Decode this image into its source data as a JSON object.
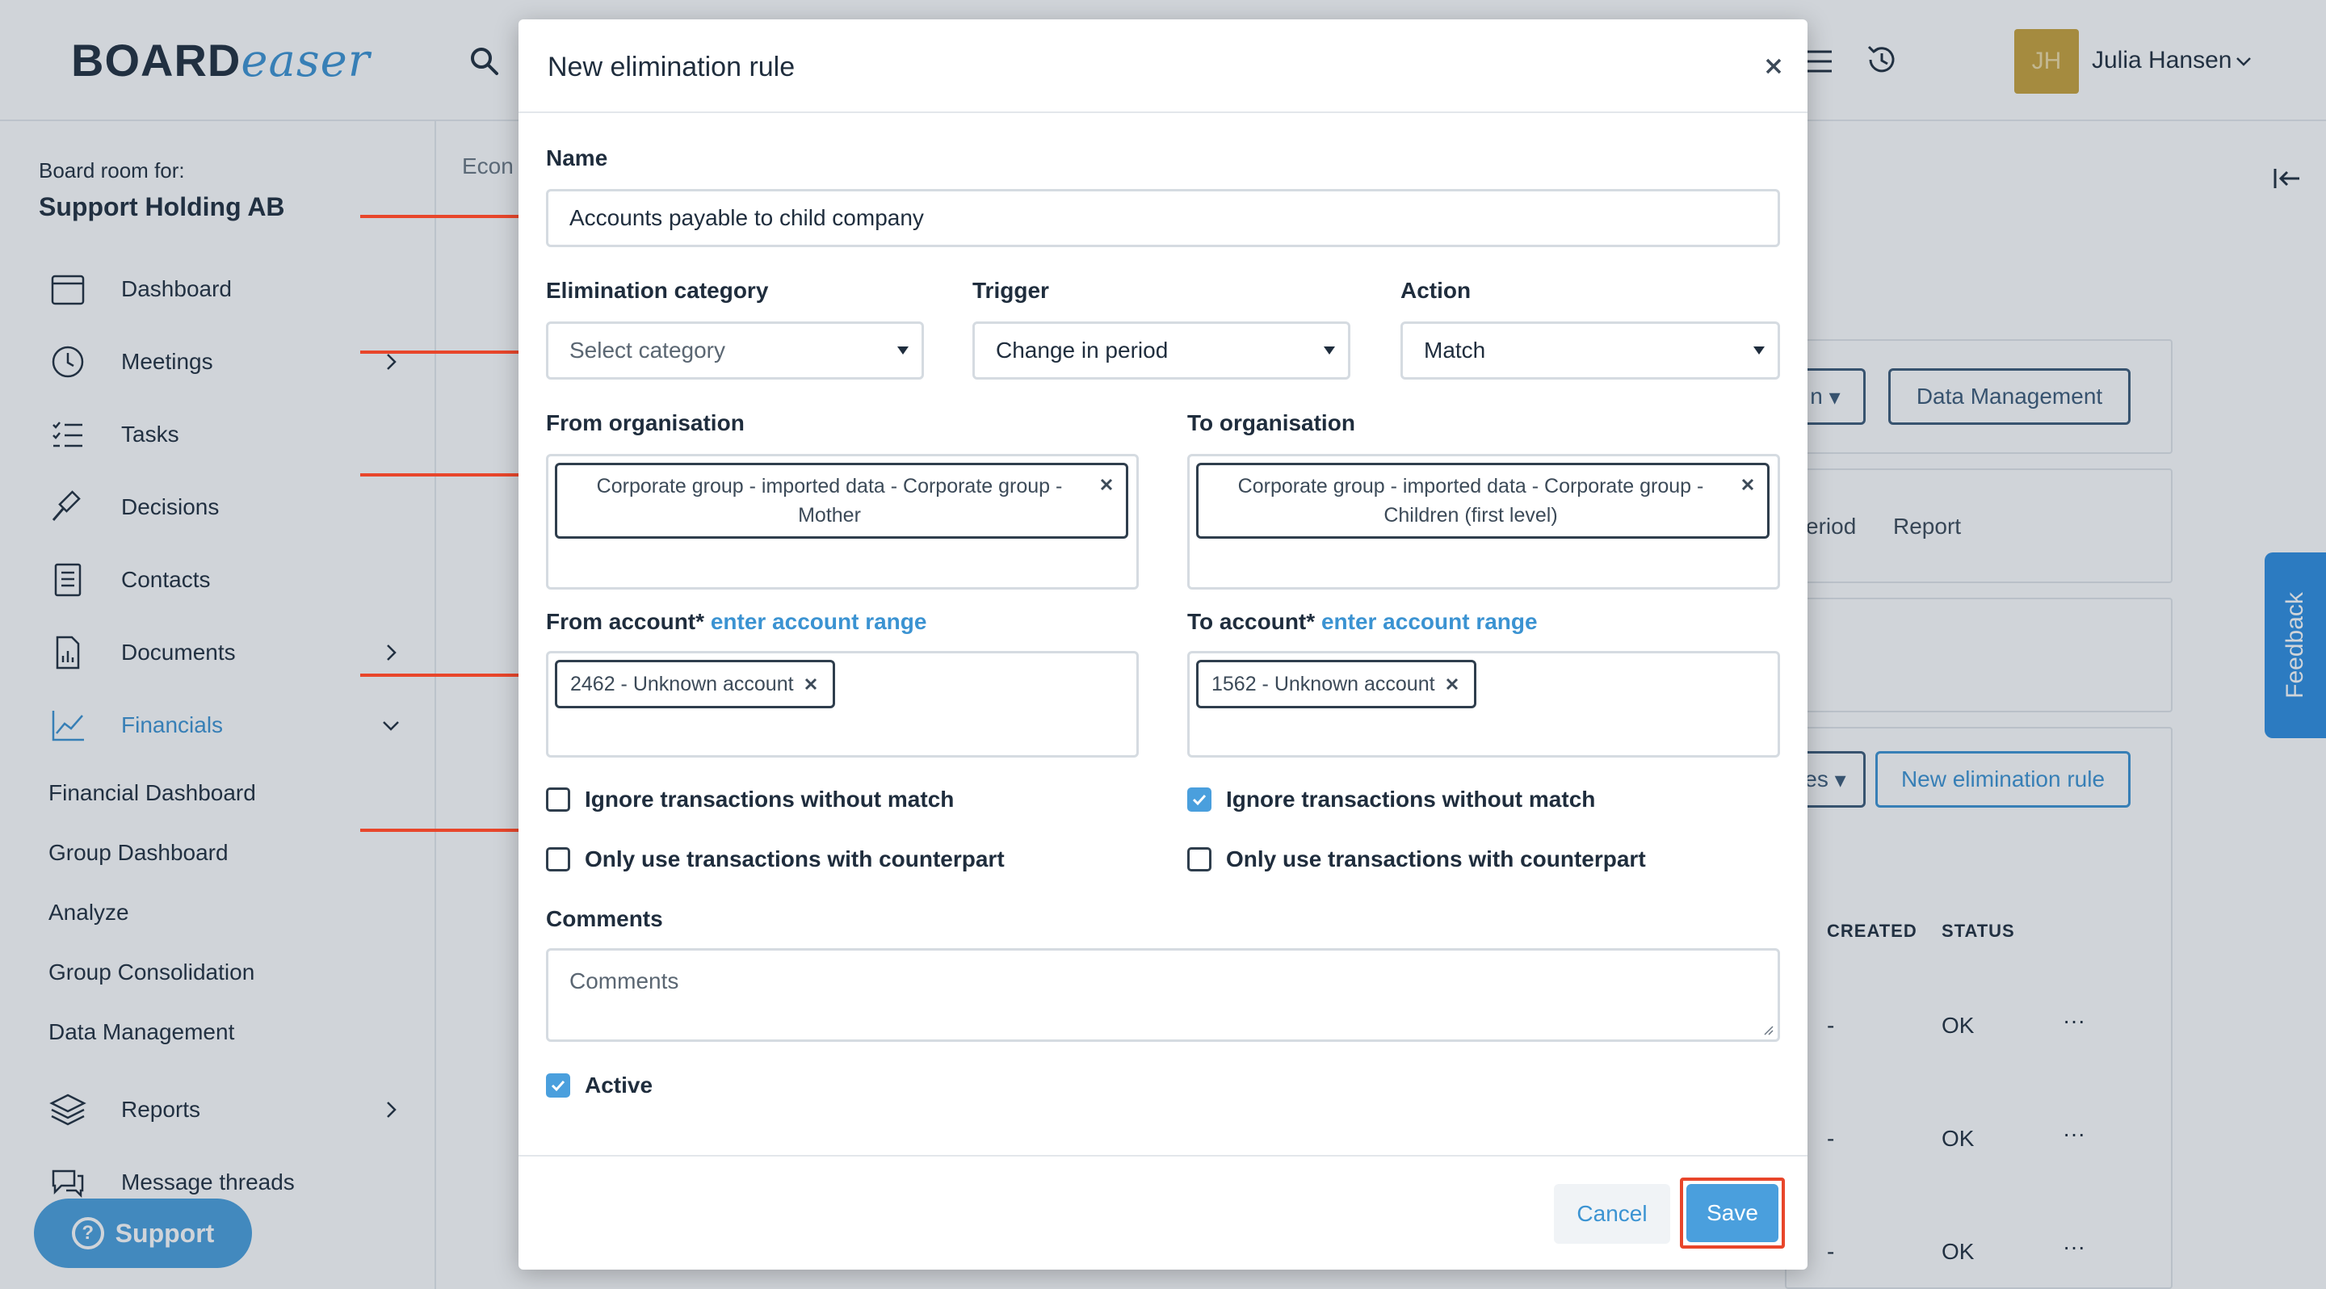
{
  "app": {
    "logo_main": "BOARD",
    "logo_accent": "easer",
    "user_initials": "JH",
    "user_name": "Julia Hansen"
  },
  "sidebar": {
    "board_for_label": "Board room for:",
    "board_name": "Support Holding AB",
    "items": [
      {
        "label": "Dashboard",
        "icon": "calendar-icon"
      },
      {
        "label": "Meetings",
        "icon": "clock-icon"
      },
      {
        "label": "Tasks",
        "icon": "checklist-icon"
      },
      {
        "label": "Decisions",
        "icon": "gavel-icon"
      },
      {
        "label": "Contacts",
        "icon": "address-book-icon"
      },
      {
        "label": "Documents",
        "icon": "document-icon"
      },
      {
        "label": "Financials",
        "icon": "chart-line-icon"
      },
      {
        "label": "Reports",
        "icon": "layers-icon"
      },
      {
        "label": "Message threads",
        "icon": "chat-icon"
      }
    ],
    "financial_subitems": [
      "Financial Dashboard",
      "Group Dashboard",
      "Analyze",
      "Group Consolidation",
      "Data Management"
    ],
    "support_label": "Support"
  },
  "background": {
    "breadcrumb": "Econ",
    "data_management_btn": "Data Management",
    "partial_dropdown_1": "n",
    "partial_dropdown_2": "es",
    "tab_period": "eriod",
    "tab_report": "Report",
    "new_rule_btn": "New elimination rule",
    "col_created": "CREATED",
    "col_status": "STATUS",
    "rows": [
      {
        "created": "-",
        "status": "OK"
      },
      {
        "created": "-",
        "status": "OK"
      },
      {
        "created": "-",
        "status": "OK"
      }
    ],
    "feedback_label": "Feedback"
  },
  "modal": {
    "title": "New elimination rule",
    "name_label": "Name",
    "name_value": "Accounts payable to child company",
    "category_label": "Elimination category",
    "category_placeholder": "Select category",
    "trigger_label": "Trigger",
    "trigger_value": "Change in period",
    "action_label": "Action",
    "action_value": "Match",
    "from_org_label": "From organisation",
    "from_org_chip_line1": "Corporate group - imported data - Corporate group -",
    "from_org_chip_line2": "Mother",
    "to_org_label": "To organisation",
    "to_org_chip_line1": "Corporate group - imported data - Corporate group -",
    "to_org_chip_line2": "Children (first level)",
    "from_account_label": "From account*",
    "to_account_label": "To account*",
    "account_range_link": "enter account range",
    "from_account_chip": "2462 - Unknown account",
    "to_account_chip": "1562 - Unknown account",
    "from_ignore_label": "Ignore transactions without match",
    "from_ignore_checked": false,
    "from_counterpart_label": "Only use transactions with counterpart",
    "from_counterpart_checked": false,
    "to_ignore_label": "Ignore transactions without match",
    "to_ignore_checked": true,
    "to_counterpart_label": "Only use transactions with counterpart",
    "to_counterpart_checked": false,
    "comments_label": "Comments",
    "comments_placeholder": "Comments",
    "active_label": "Active",
    "active_checked": true,
    "cancel_label": "Cancel",
    "save_label": "Save"
  },
  "colors": {
    "accent": "#4a9fdd",
    "annotation": "#e8462b",
    "text": "#1f2d3d"
  }
}
